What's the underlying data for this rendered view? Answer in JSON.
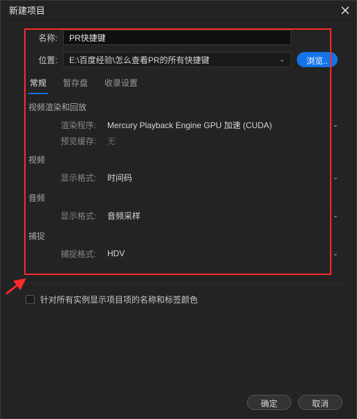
{
  "window": {
    "title": "新建项目"
  },
  "form": {
    "name": {
      "label": "名称:",
      "value": "PR快捷键"
    },
    "location": {
      "label": "位置:",
      "value": "E:\\百度经验\\怎么查看PR的所有快捷键"
    },
    "browse_label": "浏览.."
  },
  "tabs": {
    "items": [
      {
        "label": "常规",
        "active": true
      },
      {
        "label": "暂存盘",
        "active": false
      },
      {
        "label": "收录设置",
        "active": false
      }
    ]
  },
  "sections": {
    "render": {
      "title": "视频渲染和回放",
      "renderer": {
        "label": "渲染程序:",
        "value": "Mercury Playback Engine GPU 加速 (CUDA)"
      },
      "preview_cache": {
        "label": "预览缓存:",
        "value": "无"
      }
    },
    "video": {
      "title": "视频",
      "display_format": {
        "label": "显示格式:",
        "value": "时间码"
      }
    },
    "audio": {
      "title": "音频",
      "display_format": {
        "label": "显示格式:",
        "value": "音频采样"
      }
    },
    "capture": {
      "title": "捕捉",
      "capture_format": {
        "label": "捕捉格式:",
        "value": "HDV"
      }
    }
  },
  "checkbox": {
    "label": "针对所有实例显示项目项的名称和标签颜色"
  },
  "footer": {
    "ok": "确定",
    "cancel": "取消"
  }
}
